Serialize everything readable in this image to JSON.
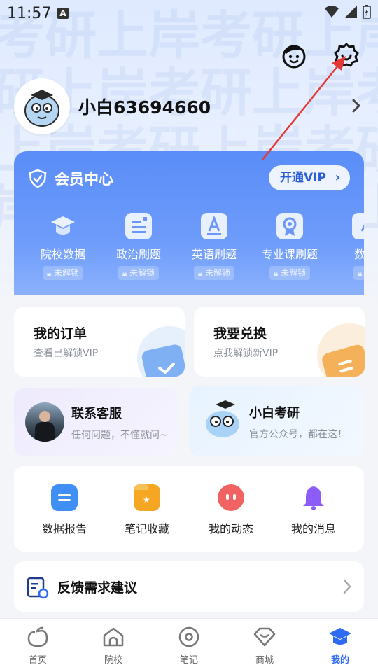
{
  "status_bar": {
    "time": "11:57",
    "notification_letter": "A"
  },
  "profile": {
    "username": "小白63694660"
  },
  "vip": {
    "title": "会员中心",
    "open_button": "开通VIP",
    "items": [
      {
        "label": "院校数据",
        "lock": "未解锁"
      },
      {
        "label": "政治刷题",
        "lock": "未解锁"
      },
      {
        "label": "英语刷题",
        "lock": "未解锁"
      },
      {
        "label": "专业课刷题",
        "lock": "未解锁"
      },
      {
        "label": "数学",
        "lock": "未"
      }
    ]
  },
  "cards": {
    "orders": {
      "title": "我的订单",
      "subtitle": "查看已解锁VIP"
    },
    "exchange": {
      "title": "我要兑换",
      "subtitle": "点我解锁新VIP"
    },
    "service": {
      "title": "联系客服",
      "subtitle": "任何问题，不懂就问~"
    },
    "official": {
      "title": "小白考研",
      "subtitle": "官方公众号，都在这！"
    }
  },
  "quick": [
    {
      "label": "数据报告"
    },
    {
      "label": "笔记收藏"
    },
    {
      "label": "我的动态"
    },
    {
      "label": "我的消息"
    }
  ],
  "feedback": {
    "label": "反馈需求建议"
  },
  "tabs": [
    {
      "label": "首页"
    },
    {
      "label": "院校"
    },
    {
      "label": "笔记"
    },
    {
      "label": "商城"
    },
    {
      "label": "我的"
    }
  ],
  "colors": {
    "accent": "#2f6bf2",
    "vip_blue": "#5a8df8",
    "annotation_red": "#e53935"
  }
}
